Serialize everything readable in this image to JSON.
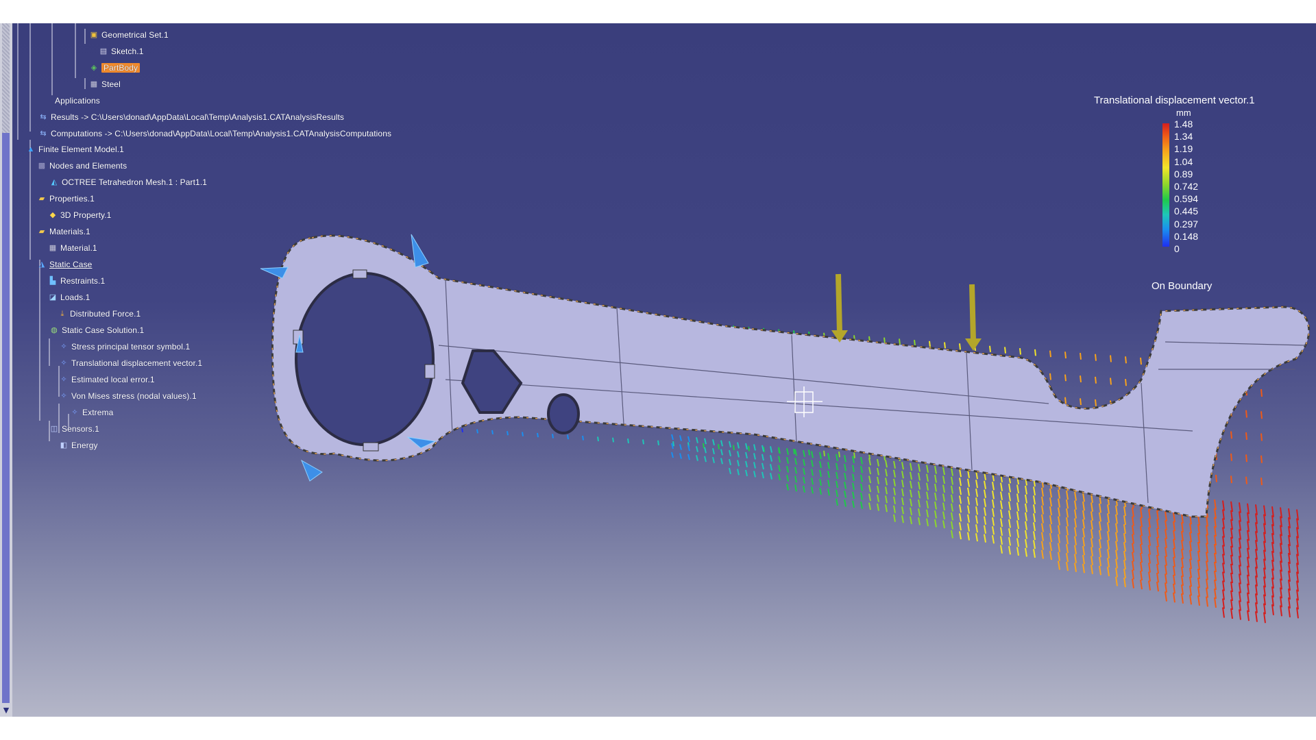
{
  "tree": {
    "items": [
      {
        "label": "Geometrical Set.1",
        "icon": "geometrical-set-icon"
      },
      {
        "label": "Sketch.1",
        "icon": "sketch-icon"
      },
      {
        "label": "PartBody",
        "icon": "partbody-icon",
        "selected": true
      },
      {
        "label": "Steel",
        "icon": "material-icon"
      },
      {
        "label": "Applications",
        "icon": ""
      },
      {
        "label": "Results -> C:\\Users\\donad\\AppData\\Local\\Temp\\Analysis1.CATAnalysisResults",
        "icon": "results-link-icon"
      },
      {
        "label": "Computations -> C:\\Users\\donad\\AppData\\Local\\Temp\\Analysis1.CATAnalysisComputations",
        "icon": "computations-link-icon"
      },
      {
        "label": "Finite Element Model.1",
        "icon": "fem-icon"
      },
      {
        "label": "Nodes and Elements",
        "icon": "nodes-elements-icon"
      },
      {
        "label": "OCTREE Tetrahedron Mesh.1 : Part1.1",
        "icon": "mesh-icon"
      },
      {
        "label": "Properties.1",
        "icon": "folder-icon"
      },
      {
        "label": "3D Property.1",
        "icon": "property-icon"
      },
      {
        "label": "Materials.1",
        "icon": "folder-icon"
      },
      {
        "label": "Material.1",
        "icon": "material-icon"
      },
      {
        "label": "Static Case",
        "icon": "static-case-icon"
      },
      {
        "label": "Restraints.1",
        "icon": "restraint-icon"
      },
      {
        "label": "Loads.1",
        "icon": "loads-icon"
      },
      {
        "label": "Distributed Force.1",
        "icon": "force-icon"
      },
      {
        "label": "Static Case Solution.1",
        "icon": "solution-icon"
      },
      {
        "label": "Stress principal tensor symbol.1",
        "icon": "image-icon"
      },
      {
        "label": "Translational displacement vector.1",
        "icon": "image-icon"
      },
      {
        "label": "Estimated local error.1",
        "icon": "image-icon"
      },
      {
        "label": "Von Mises stress (nodal values).1",
        "icon": "image-icon"
      },
      {
        "label": "Extrema",
        "icon": "extrema-icon"
      },
      {
        "label": "Sensors.1",
        "icon": "sensors-icon"
      },
      {
        "label": "Energy",
        "icon": "energy-icon"
      }
    ]
  },
  "legend": {
    "title": "Translational displacement vector.1",
    "unit": "mm",
    "ticks": [
      "1.48",
      "1.34",
      "1.19",
      "1.04",
      "0.89",
      "0.742",
      "0.594",
      "0.445",
      "0.297",
      "0.148",
      "0"
    ],
    "footer": "On Boundary"
  },
  "colors": {
    "viewport_top": "#3a3e7c",
    "part_face": "#b7b7df",
    "selection": "#f08a2c",
    "restraint": "#3d8fe8",
    "load_arrow": "#b4a62a"
  }
}
